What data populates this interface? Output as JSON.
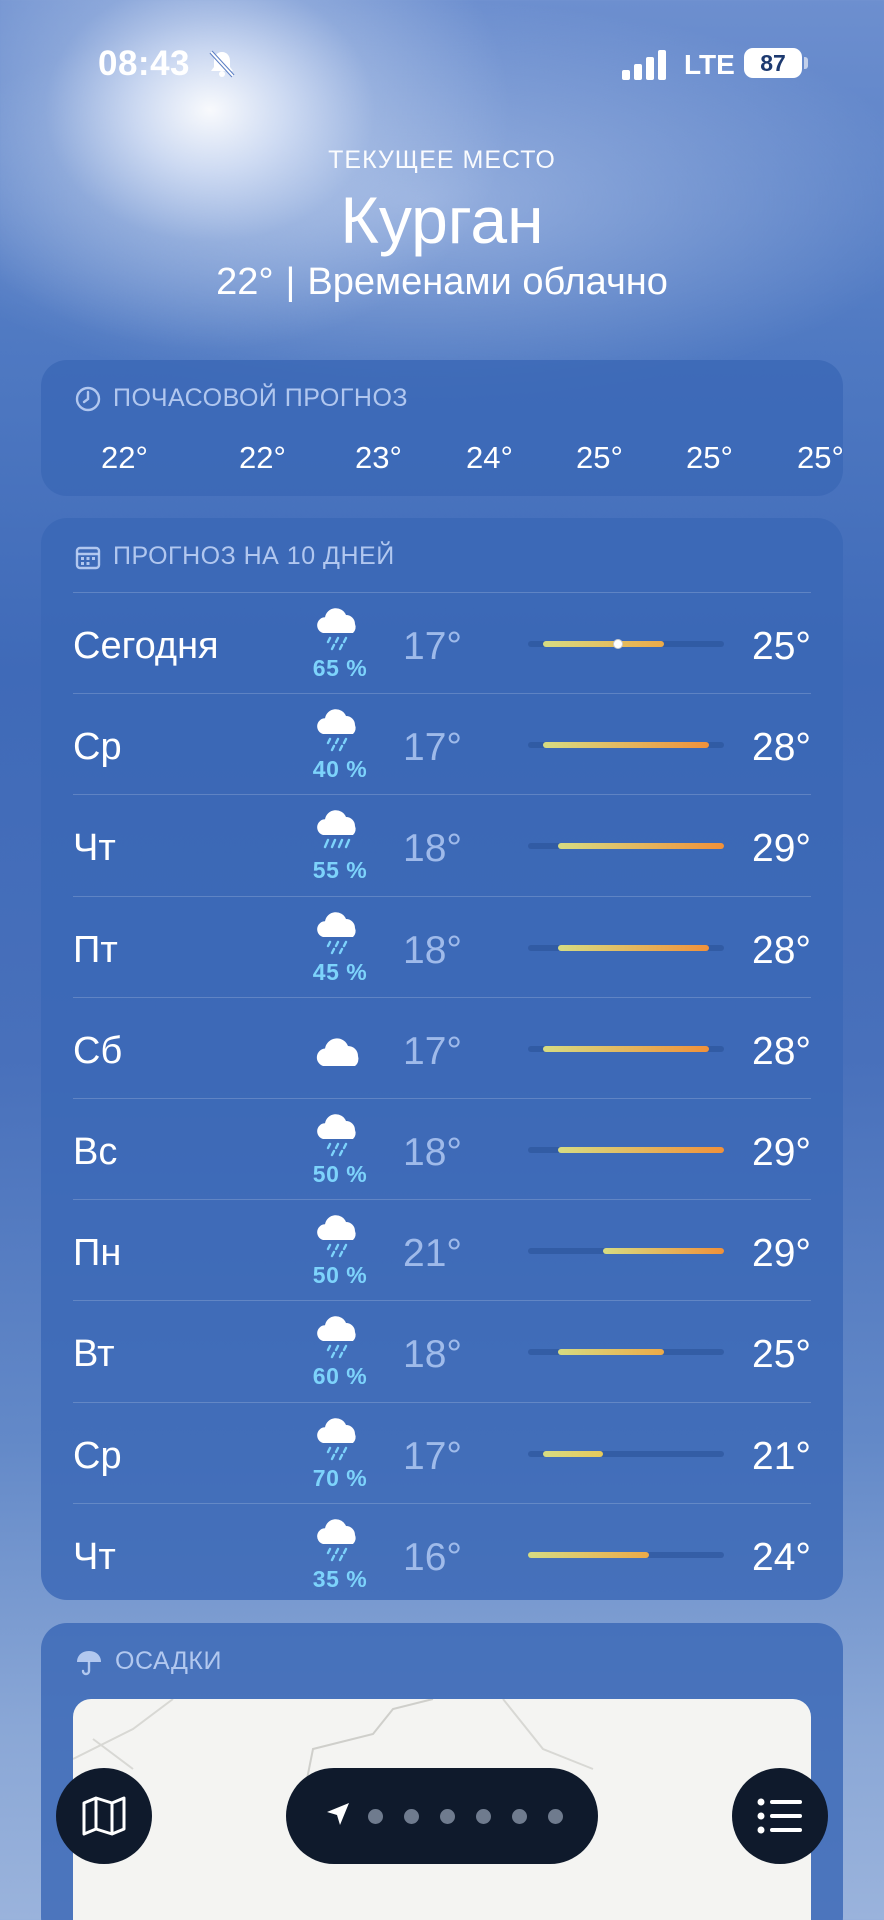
{
  "status_bar": {
    "time": "08:43",
    "network": "LTE",
    "battery": "87"
  },
  "header": {
    "location_label": "ТЕКУЩЕЕ МЕСТО",
    "city": "Курган",
    "current_temp": "22°",
    "separator": "|",
    "condition": "Временами облачно"
  },
  "hourly": {
    "title": "ПОЧАСОВОЙ ПРОГНОЗ",
    "temps": [
      "22°",
      "22°",
      "23°",
      "24°",
      "25°",
      "25°",
      "25°"
    ]
  },
  "daily": {
    "title": "ПРОГНОЗ НА 10 ДНЕЙ",
    "range_min": 16,
    "range_max": 29,
    "days": [
      {
        "name": "Сегодня",
        "icon": "cloud-rain-icon",
        "precip": "65 %",
        "low": "17°",
        "high": "25°",
        "low_val": 17,
        "high_val": 25,
        "current_val": 22
      },
      {
        "name": "Ср",
        "icon": "cloud-rain-icon",
        "precip": "40 %",
        "low": "17°",
        "high": "28°",
        "low_val": 17,
        "high_val": 28
      },
      {
        "name": "Чт",
        "icon": "cloud-heavy-rain-icon",
        "precip": "55 %",
        "low": "18°",
        "high": "29°",
        "low_val": 18,
        "high_val": 29
      },
      {
        "name": "Пт",
        "icon": "cloud-rain-icon",
        "precip": "45 %",
        "low": "18°",
        "high": "28°",
        "low_val": 18,
        "high_val": 28
      },
      {
        "name": "Сб",
        "icon": "cloud-icon",
        "precip": "",
        "low": "17°",
        "high": "28°",
        "low_val": 17,
        "high_val": 28
      },
      {
        "name": "Вс",
        "icon": "cloud-rain-icon",
        "precip": "50 %",
        "low": "18°",
        "high": "29°",
        "low_val": 18,
        "high_val": 29
      },
      {
        "name": "Пн",
        "icon": "cloud-rain-icon",
        "precip": "50 %",
        "low": "21°",
        "high": "29°",
        "low_val": 21,
        "high_val": 29
      },
      {
        "name": "Вт",
        "icon": "cloud-rain-icon",
        "precip": "60 %",
        "low": "18°",
        "high": "25°",
        "low_val": 18,
        "high_val": 25
      },
      {
        "name": "Ср",
        "icon": "cloud-rain-icon",
        "precip": "70 %",
        "low": "17°",
        "high": "21°",
        "low_val": 17,
        "high_val": 21
      },
      {
        "name": "Чт",
        "icon": "cloud-rain-icon",
        "precip": "35 %",
        "low": "16°",
        "high": "24°",
        "low_val": 16,
        "high_val": 24
      }
    ]
  },
  "precipitation": {
    "title": "ОСАДКИ"
  },
  "colors": {
    "precip": "#7dd3fb",
    "card": "#3a68b6",
    "bar_cool": "#d7dc82",
    "bar_warm": "#f0913a",
    "controls": "#0f1a2c"
  }
}
